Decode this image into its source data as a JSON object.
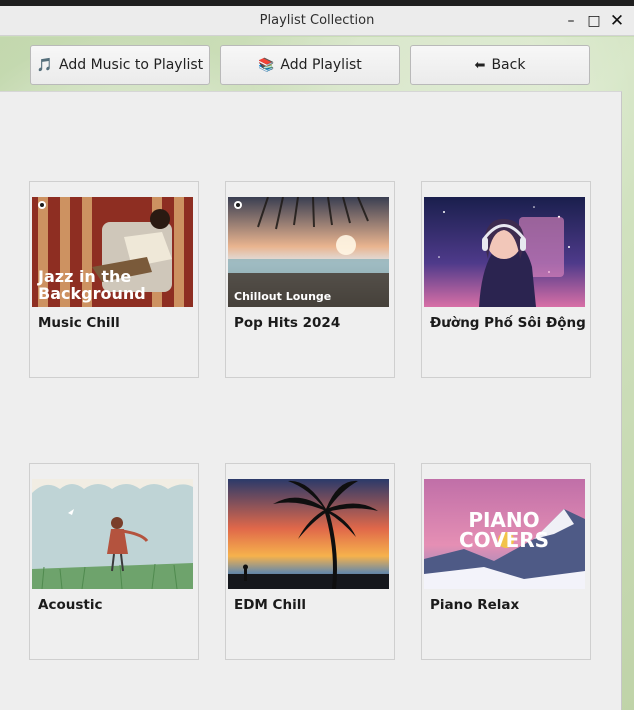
{
  "window": {
    "title": "Playlist Collection",
    "controls": {
      "minimize": "–",
      "maximize": "□",
      "close": "✕"
    }
  },
  "toolbar": {
    "add_music": {
      "icon": "music-note-icon",
      "glyph": "🎵",
      "label": "Add Music to Playlist"
    },
    "add_playlist": {
      "icon": "books-icon",
      "glyph": "📚",
      "label": "Add Playlist"
    },
    "back": {
      "icon": "left-arrow-icon",
      "glyph": "⬅",
      "label": "Back"
    }
  },
  "playlists": [
    {
      "name": "Music Chill",
      "cover_text": [
        "Jazz in the",
        "Background"
      ]
    },
    {
      "name": "Pop Hits 2024",
      "cover_text": [
        "Chillout Lounge"
      ]
    },
    {
      "name": "Đường Phố Sôi Động",
      "cover_text": []
    },
    {
      "name": "Acoustic",
      "cover_text": []
    },
    {
      "name": "EDM Chill",
      "cover_text": []
    },
    {
      "name": "Piano Relax",
      "cover_text": [
        "PIANO",
        "COVERS"
      ]
    }
  ]
}
